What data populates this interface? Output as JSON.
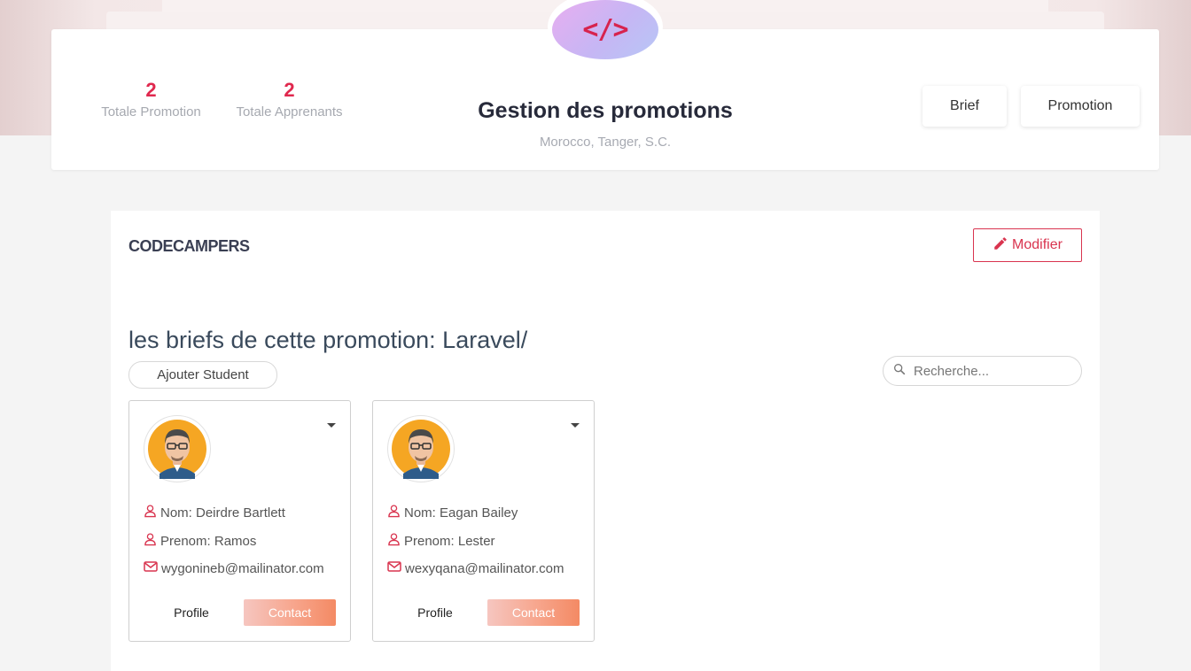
{
  "header": {
    "logo_text": "</>",
    "stats": [
      {
        "value": "2",
        "label": "Totale Promotion"
      },
      {
        "value": "2",
        "label": "Totale Apprenants"
      }
    ],
    "title": "Gestion des promotions",
    "subtitle": "Morocco, Tanger, S.C.",
    "nav": {
      "brief": "Brief",
      "promotion": "Promotion"
    }
  },
  "promotion": {
    "name": "CODECAMPERS",
    "edit_label": "Modifier",
    "section_title": "les briefs de cette promotion: Laravel/",
    "add_student_label": "Ajouter Student",
    "search_placeholder": "Recherche..."
  },
  "students": [
    {
      "nom": "Nom: Deirdre Bartlett",
      "prenom": "Prenom: Ramos",
      "email": "wygonineb@mailinator.com",
      "profile_label": "Profile",
      "contact_label": "Contact"
    },
    {
      "nom": "Nom: Eagan Bailey",
      "prenom": "Prenom: Lester",
      "email": "wexyqana@mailinator.com",
      "profile_label": "Profile",
      "contact_label": "Contact"
    }
  ],
  "colors": {
    "accent": "#e0284e",
    "contact_gradient_end": "#f48a64"
  },
  "icons": [
    "code-icon",
    "pencil-icon",
    "search-icon",
    "user-icon",
    "mail-icon",
    "caret-down-icon"
  ]
}
